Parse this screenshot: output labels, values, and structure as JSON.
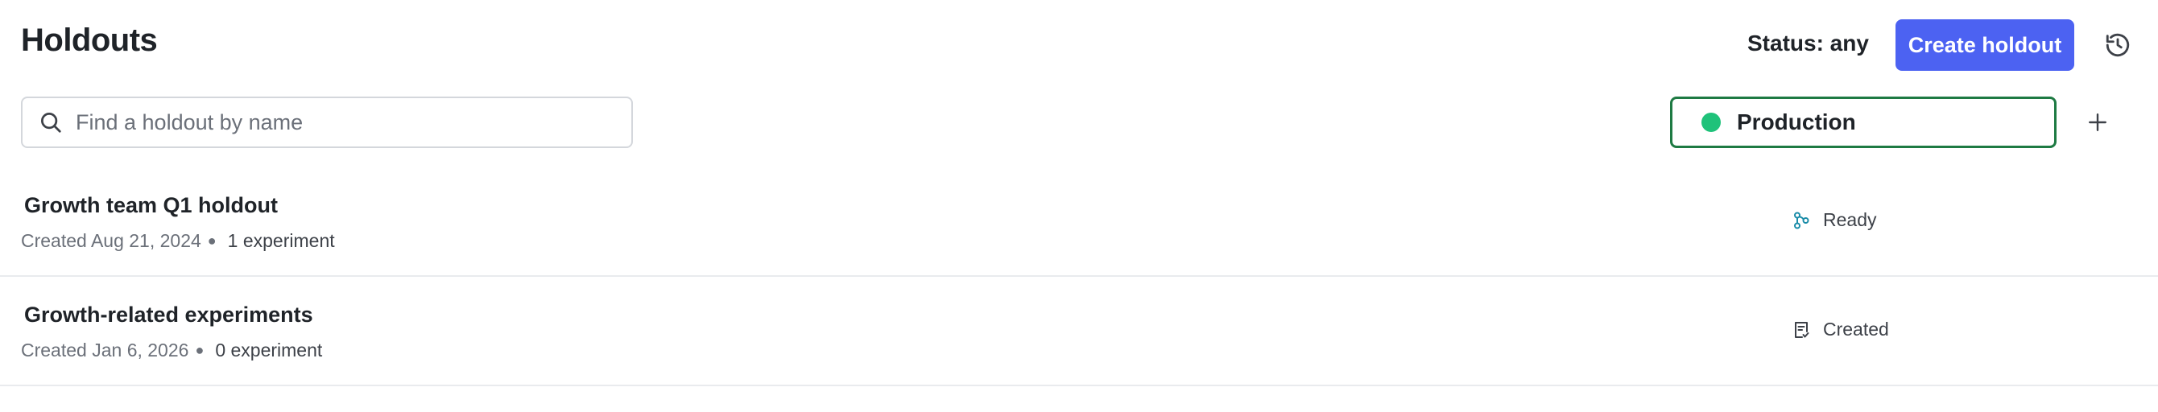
{
  "header": {
    "title": "Holdouts",
    "status_filter": "Status: any",
    "create_button": "Create holdout",
    "history_icon": "history-icon"
  },
  "search": {
    "placeholder": "Find a holdout by name",
    "value": "",
    "icon": "search-icon"
  },
  "environment": {
    "label": "Production",
    "dot_color": "#1fc27a",
    "border_color": "#1e7a43",
    "add_icon": "plus-icon"
  },
  "colors": {
    "accent": "#4c62f2",
    "ready_icon": "#1a8ca8"
  },
  "holdouts": [
    {
      "name": "Growth team Q1 holdout",
      "created": "Created Aug 21, 2024",
      "experiments": "1 experiment",
      "status": "Ready",
      "status_icon": "ready-icon"
    },
    {
      "name": "Growth-related experiments",
      "created": "Created Jan 6, 2026",
      "experiments": "0 experiment",
      "status": "Created",
      "status_icon": "created-icon"
    }
  ]
}
